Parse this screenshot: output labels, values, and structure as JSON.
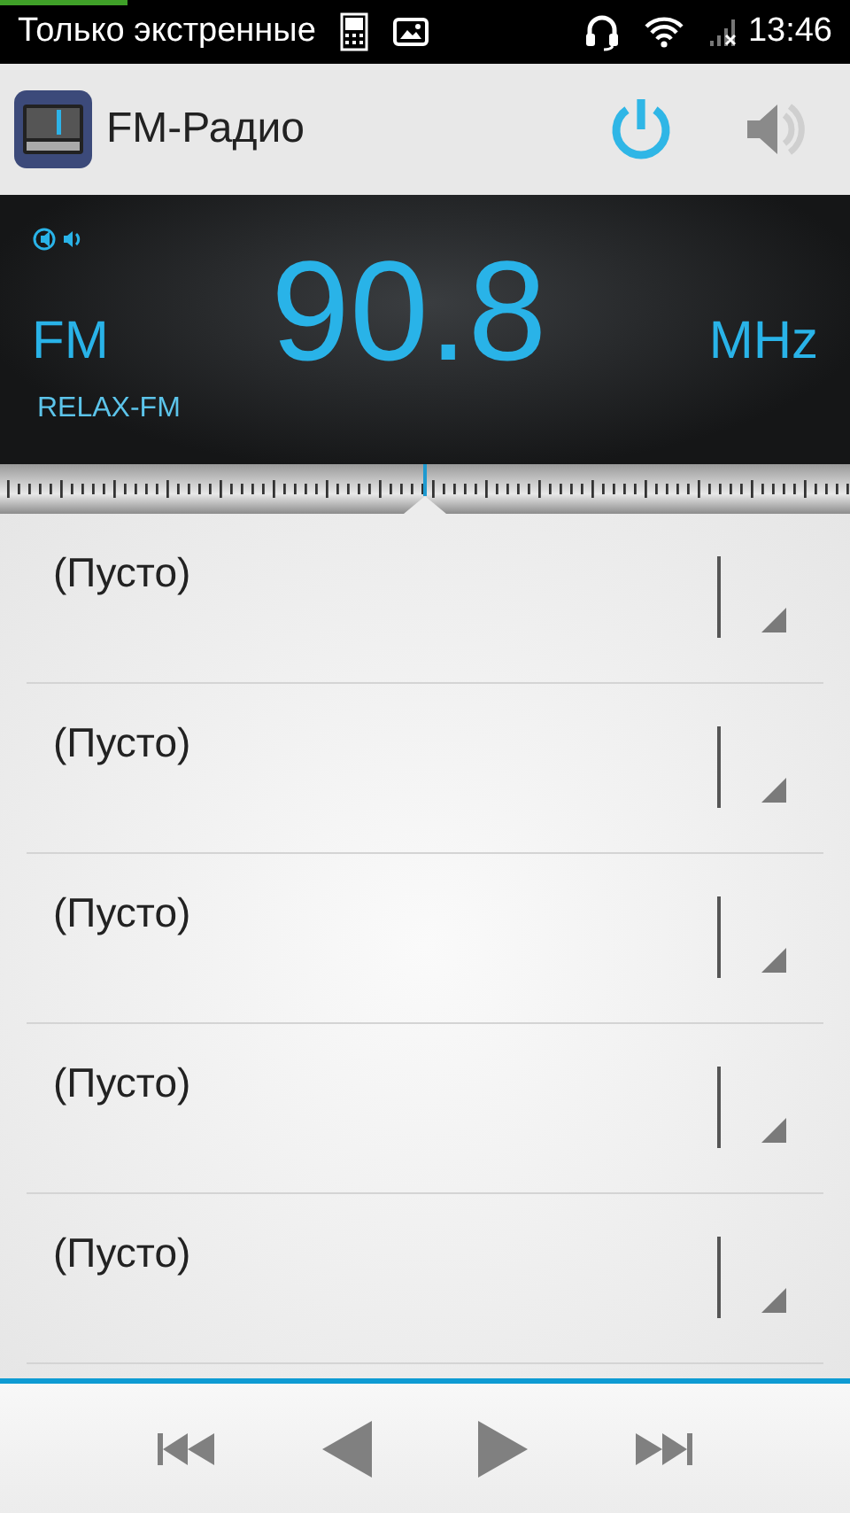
{
  "status_bar": {
    "notification": "Только экстренные",
    "time": "13:46"
  },
  "action_bar": {
    "title": "FM-Радио"
  },
  "display": {
    "band": "FM",
    "frequency": "90.8",
    "unit": "MHz",
    "station": "RELAX-FM"
  },
  "presets": [
    {
      "label": "(Пусто)"
    },
    {
      "label": "(Пусто)"
    },
    {
      "label": "(Пусто)"
    },
    {
      "label": "(Пусто)"
    },
    {
      "label": "(Пусто)"
    }
  ]
}
